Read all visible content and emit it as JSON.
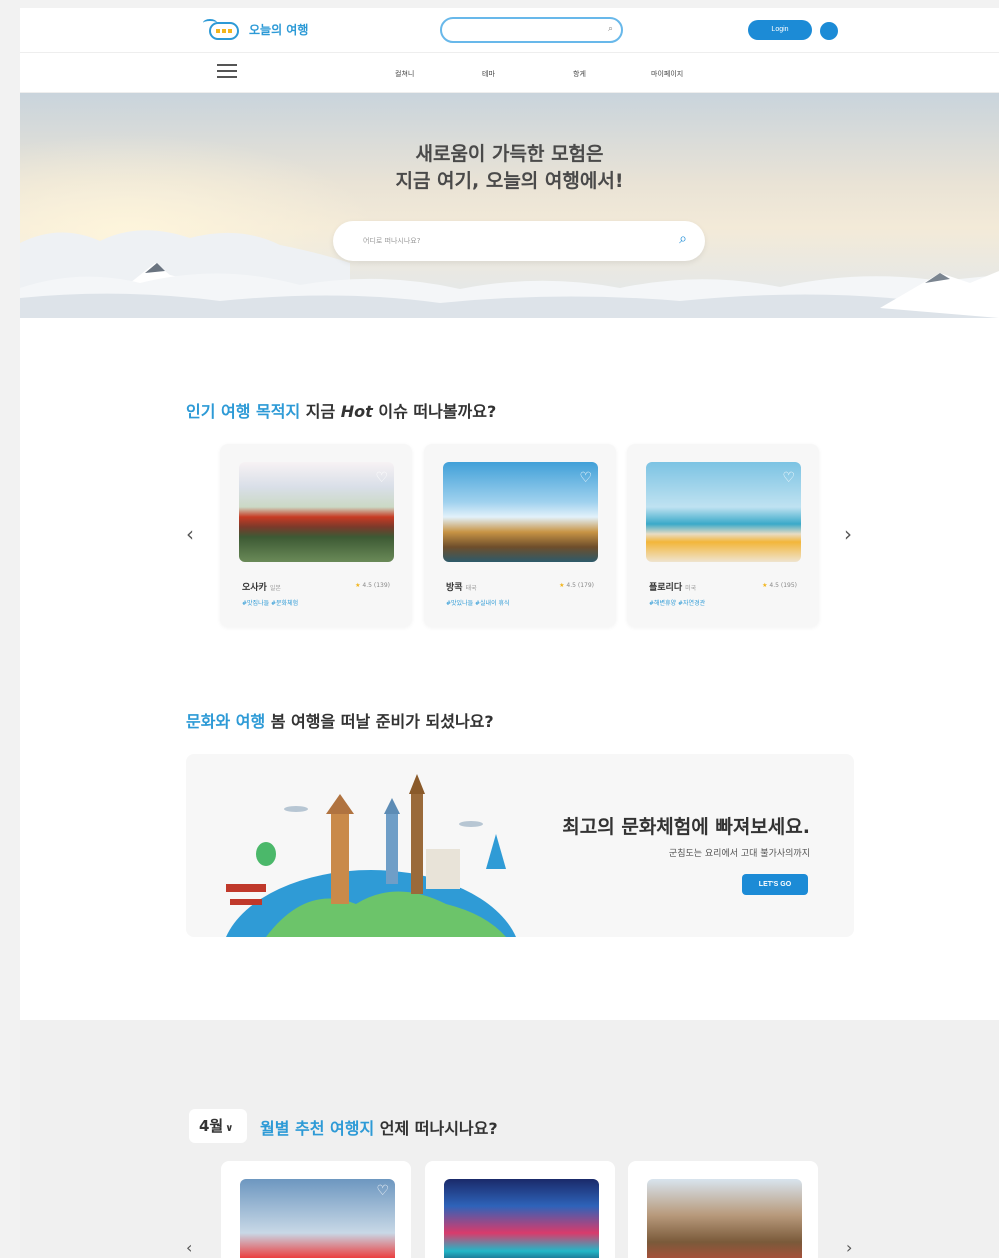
{
  "header": {
    "logo_text": "오늘의 여행",
    "login_label": "Login"
  },
  "nav": {
    "items": [
      "컬쳐니",
      "테마",
      "항게",
      "마이페이지"
    ]
  },
  "hero": {
    "line1": "새로움이 가득한 모험은",
    "line2": "지금 여기, 오늘의 여행에서!",
    "search_placeholder": "어디로 떠나시나요?"
  },
  "popular": {
    "title_highlight": "인기 여행 목적지",
    "title_rest_a": " 지금 ",
    "title_hot": "Hot",
    "title_rest_b": " 이슈 떠나볼까요?",
    "cards": [
      {
        "name": "오사카",
        "country": "일본",
        "rating": "4.5 (139)",
        "tags": "#맛집나들 #문화체험"
      },
      {
        "name": "방콕",
        "country": "태국",
        "rating": "4.5 (179)",
        "tags": "#맛있나들 #실내이 휴식"
      },
      {
        "name": "플로리다",
        "country": "미국",
        "rating": "4.5 (195)",
        "tags": "#해변휴양 #자연경관"
      }
    ]
  },
  "culture": {
    "title_highlight": "문화와 여행",
    "title_rest": " 봄 여행을 떠날 준비가 되셨나요?",
    "banner_title": "최고의 문화체험에 빠져보세요.",
    "banner_sub": "군침도는 요리에서 고대 불가사의까지",
    "cta_label": "LET'S GO"
  },
  "monthly": {
    "month": "4월",
    "title_highlight": "월별 추천 여행지",
    "title_rest": " 언제 떠나시나요?"
  },
  "icons": {
    "prev": "‹",
    "next": "›",
    "heart": "♡",
    "star": "★",
    "search": "⌕",
    "chevron": "∨"
  },
  "colors": {
    "accent": "#2d9ad6",
    "button": "#1c8bd6"
  }
}
